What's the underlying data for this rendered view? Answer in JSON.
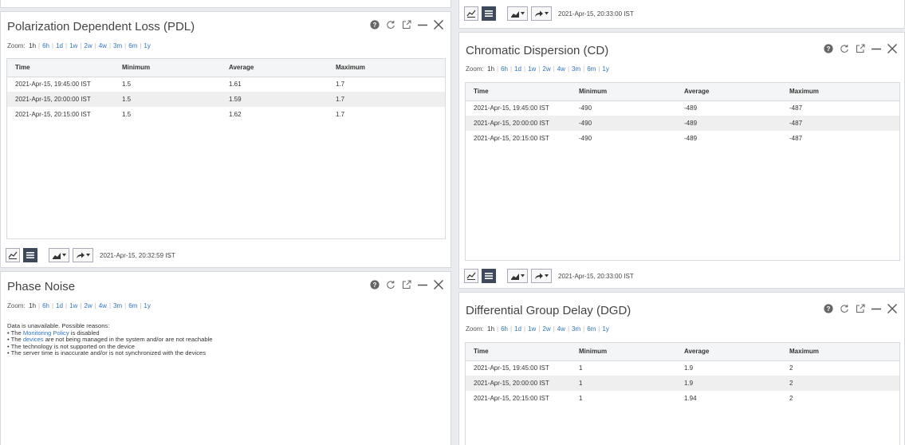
{
  "colors": {
    "link": "#2f74c0",
    "toolbar_dark": "#3e4a5c",
    "panel_border": "#d6d9dd"
  },
  "zoom": {
    "label": "Zoom:",
    "options": [
      "1h",
      "6h",
      "1d",
      "1w",
      "2w",
      "4w",
      "3m",
      "6m",
      "1y"
    ]
  },
  "columns": [
    "Time",
    "Minimum",
    "Average",
    "Maximum"
  ],
  "icons": [
    "help-icon",
    "refresh-icon",
    "popout-icon",
    "minimize-icon",
    "close-icon",
    "line-chart-icon",
    "table-view-icon",
    "chart-type-icon",
    "share-icon"
  ],
  "top_right_strip": {
    "timestamp": "2021-Apr-15, 20:33:00 IST"
  },
  "pdl": {
    "title": "Polarization Dependent Loss (PDL)",
    "rows": [
      {
        "time": "2021-Apr-15, 19:45:00 IST",
        "min": "1.5",
        "avg": "1.61",
        "max": "1.7"
      },
      {
        "time": "2021-Apr-15, 20:00:00 IST",
        "min": "1.5",
        "avg": "1.59",
        "max": "1.7"
      },
      {
        "time": "2021-Apr-15, 20:15:00 IST",
        "min": "1.5",
        "avg": "1.62",
        "max": "1.7"
      }
    ],
    "timestamp": "2021-Apr-15, 20:32:59 IST"
  },
  "cd": {
    "title": "Chromatic Dispersion (CD)",
    "rows": [
      {
        "time": "2021-Apr-15, 19:45:00 IST",
        "min": "-490",
        "avg": "-489",
        "max": "-487"
      },
      {
        "time": "2021-Apr-15, 20:00:00 IST",
        "min": "-490",
        "avg": "-489",
        "max": "-487"
      },
      {
        "time": "2021-Apr-15, 20:15:00 IST",
        "min": "-490",
        "avg": "-489",
        "max": "-487"
      }
    ],
    "timestamp": "2021-Apr-15, 20:33:00 IST"
  },
  "phase": {
    "title": "Phase Noise",
    "msg": {
      "intro": "Data is unavailable. Possible reasons:",
      "r1_pre": "• The ",
      "r1_link": "Monitoring Policy",
      "r1_post": " is disabled",
      "r2_pre": "• The ",
      "r2_link": "devices",
      "r2_post": " are not being managed in the system and/or are not reachable",
      "r3": "• The technology is not supported on the device",
      "r4": "• The server time is inaccurate and/or is not synchronized with the devices"
    }
  },
  "dgd": {
    "title": "Differential Group Delay (DGD)",
    "rows": [
      {
        "time": "2021-Apr-15, 19:45:00 IST",
        "min": "1",
        "avg": "1.9",
        "max": "2"
      },
      {
        "time": "2021-Apr-15, 20:00:00 IST",
        "min": "1",
        "avg": "1.9",
        "max": "2"
      },
      {
        "time": "2021-Apr-15, 20:15:00 IST",
        "min": "1",
        "avg": "1.94",
        "max": "2"
      }
    ]
  }
}
